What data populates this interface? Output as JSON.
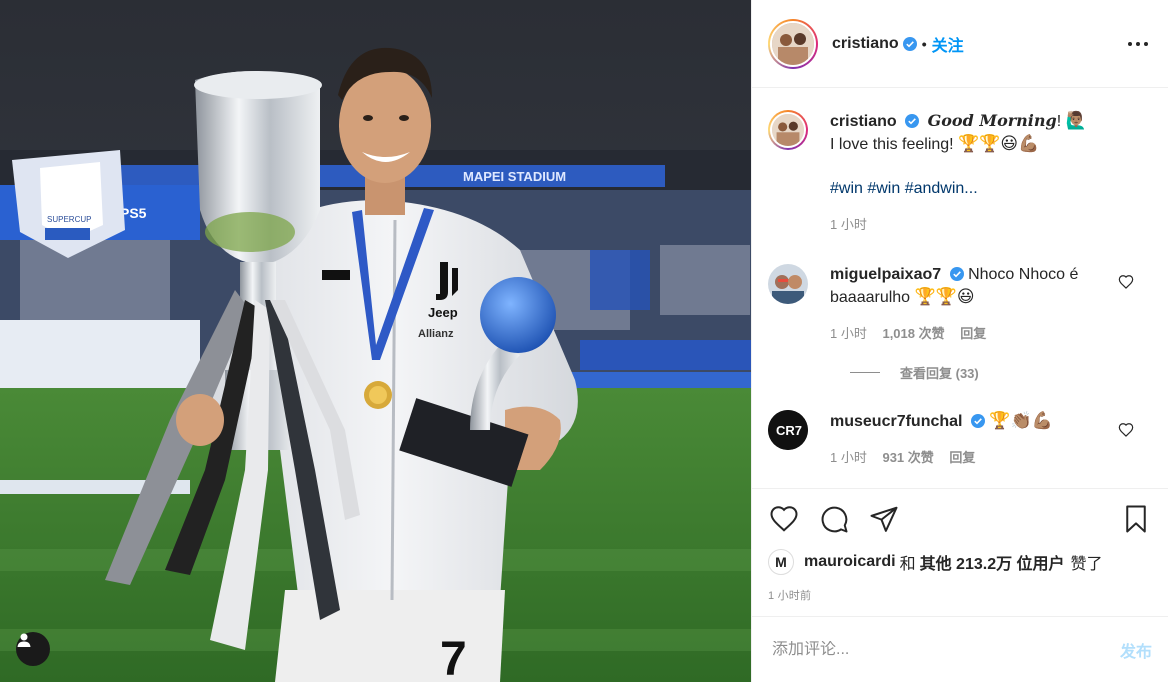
{
  "post": {
    "author": "cristiano",
    "follow_label": "关注",
    "separator": "•"
  },
  "caption": {
    "username": "cristiano",
    "text_bold": "Good Morning",
    "text_exclaim": "!",
    "text_emoji": "🙋🏽‍♂️",
    "line2": "I love this feeling!",
    "line2_emoji": "🏆🏆😃💪🏽",
    "hashtags": "#win #win #andwin...",
    "time": "1 小时"
  },
  "comments": [
    {
      "username": "miguelpaixao7",
      "text": "Nhoco Nhoco é baaaarulho",
      "emoji": "🏆🏆😃",
      "time": "1 小时",
      "likes": "1,018 次赞",
      "reply_label": "回复"
    },
    {
      "username": "museucr7funchal",
      "text": "",
      "emoji": "🏆👏🏽💪🏽",
      "time": "1 小时",
      "likes": "931 次赞",
      "reply_label": "回复"
    }
  ],
  "view_replies": "查看回复 (33)",
  "liked_by": {
    "user": "mauroicardi",
    "and": "和",
    "others": "其他 213.2万 位用户",
    "suffix": "赞了"
  },
  "posted_ago": "1 小时前",
  "composer": {
    "placeholder": "添加评论...",
    "post_label": "发布"
  },
  "photo_texts": {
    "stadium": "MAPEI STADIUM",
    "supercup": "SUPERCUP",
    "ps5": "PS5",
    "sponsor1": "Jeep",
    "sponsor2": "Allianz",
    "number": "7"
  },
  "colors": {
    "accent": "#0095f6",
    "verified": "#3897f0",
    "pitch": "#3d7a2f",
    "jacket": "#f1f2f4"
  }
}
